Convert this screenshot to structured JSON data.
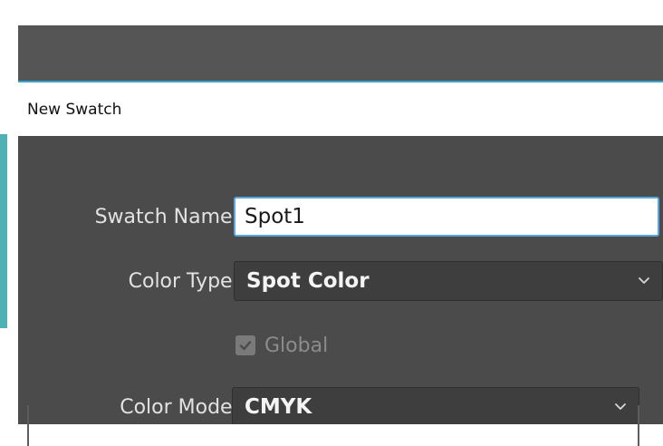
{
  "dialog": {
    "title": "New Swatch"
  },
  "fields": {
    "swatch_name": {
      "label": "Swatch Name:",
      "value": "Spot1"
    },
    "color_type": {
      "label": "Color Type:",
      "selected": "Spot Color"
    },
    "global": {
      "label": "Global",
      "checked": true
    },
    "color_mode": {
      "label": "Color Mode:",
      "selected": "CMYK"
    }
  },
  "icons": {
    "color_type_dropdown": "chevron-down-icon",
    "color_mode_dropdown": "chevron-down-icon",
    "global_check": "checkmark-icon"
  },
  "colors": {
    "dialog_bg": "#4b4b4b",
    "focus_border": "#5aa7e0",
    "accent_strip": "#4fb1b3"
  }
}
